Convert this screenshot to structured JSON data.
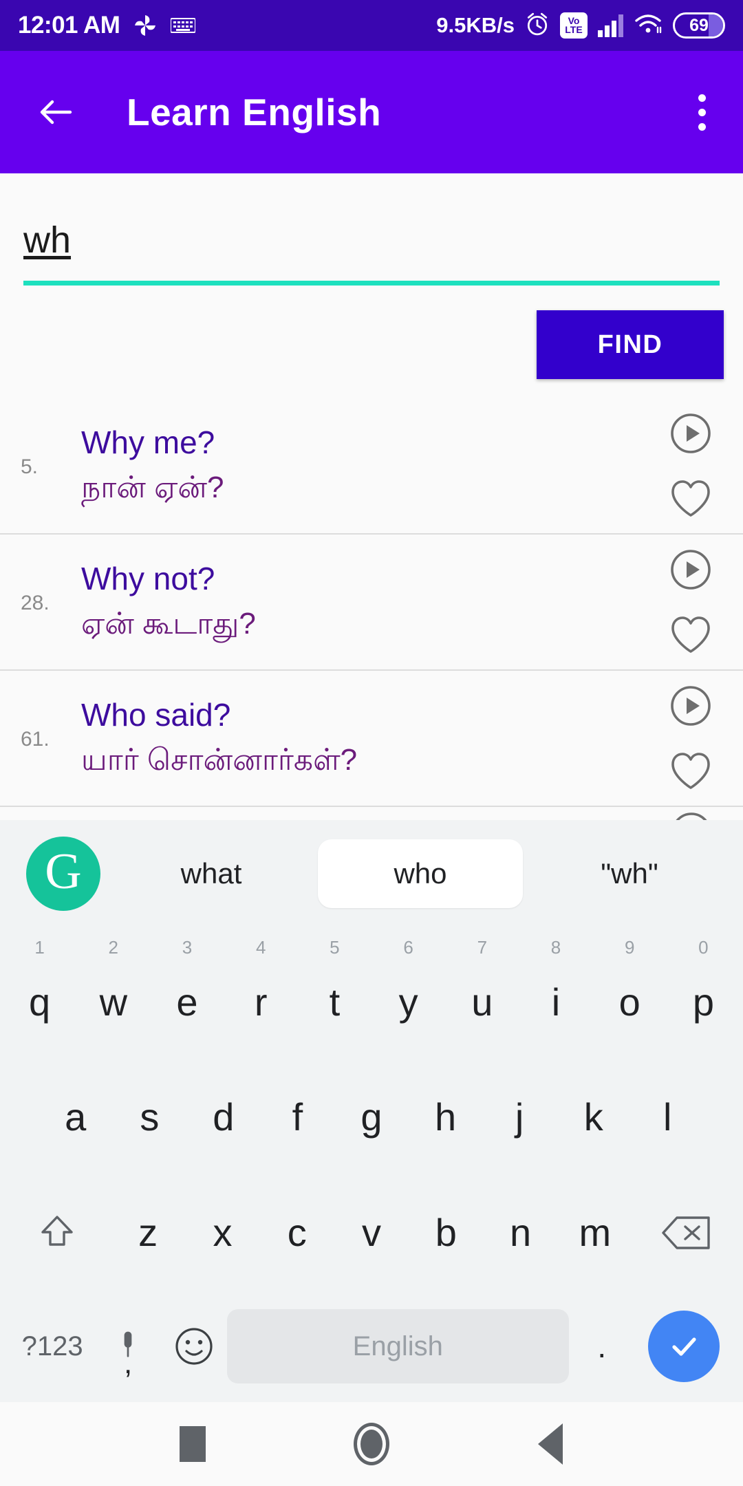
{
  "status_bar": {
    "time": "12:01 AM",
    "network_speed": "9.5KB/s",
    "volte_top": "Vo",
    "volte_bottom": "LTE",
    "battery_level": "69",
    "icons": [
      "pinwheel-icon",
      "keyboard-icon",
      "alarm-icon",
      "volte-icon",
      "signal-bars-icon",
      "wifi-icon",
      "battery-icon"
    ],
    "bg_color": "#3A06B0"
  },
  "app_bar": {
    "title": "Learn English",
    "back_icon": "back-arrow-icon",
    "overflow_icon": "kebab-menu-icon",
    "bg_color": "#6600EE"
  },
  "search": {
    "value": "wh",
    "placeholder": "",
    "underline_color": "#1DE0BE"
  },
  "find_button": {
    "label": "FIND",
    "bg_color": "#3300CC"
  },
  "results": [
    {
      "number": "5.",
      "english": "Why me?",
      "tamil": "நான் ஏன்?",
      "play_icon": "play-circle-icon",
      "favorite_icon": "heart-outline-icon"
    },
    {
      "number": "28.",
      "english": "Why not?",
      "tamil": "ஏன் கூடாது?",
      "play_icon": "play-circle-icon",
      "favorite_icon": "heart-outline-icon"
    },
    {
      "number": "61.",
      "english": "Who said?",
      "tamil": "யார் சொன்னார்கள்?",
      "play_icon": "play-circle-icon",
      "favorite_icon": "heart-outline-icon"
    }
  ],
  "result_colors": {
    "english": "#3D0C9E",
    "tamil": "#6B1B7B",
    "number": "#8a8a8a"
  },
  "keyboard": {
    "logo_letter": "G",
    "logo_name": "grammarly-logo-icon",
    "logo_color": "#15C39A",
    "suggestions": [
      {
        "text": "what",
        "active": false
      },
      {
        "text": "who",
        "active": true
      },
      {
        "text": "\"wh\"",
        "active": false
      }
    ],
    "row1": [
      {
        "letter": "q",
        "num": "1"
      },
      {
        "letter": "w",
        "num": "2"
      },
      {
        "letter": "e",
        "num": "3"
      },
      {
        "letter": "r",
        "num": "4"
      },
      {
        "letter": "t",
        "num": "5"
      },
      {
        "letter": "y",
        "num": "6"
      },
      {
        "letter": "u",
        "num": "7"
      },
      {
        "letter": "i",
        "num": "8"
      },
      {
        "letter": "o",
        "num": "9"
      },
      {
        "letter": "p",
        "num": "0"
      }
    ],
    "row2": [
      {
        "letter": "a"
      },
      {
        "letter": "s"
      },
      {
        "letter": "d"
      },
      {
        "letter": "f"
      },
      {
        "letter": "g"
      },
      {
        "letter": "h"
      },
      {
        "letter": "j"
      },
      {
        "letter": "k"
      },
      {
        "letter": "l"
      }
    ],
    "row3": [
      {
        "letter": "z"
      },
      {
        "letter": "x"
      },
      {
        "letter": "c"
      },
      {
        "letter": "v"
      },
      {
        "letter": "b"
      },
      {
        "letter": "n"
      },
      {
        "letter": "m"
      }
    ],
    "shift_icon": "shift-arrow-icon",
    "backspace_icon": "backspace-icon",
    "symbols_label": "?123",
    "mic_icon": "microphone-icon",
    "comma_label": ",",
    "emoji_icon": "emoji-smiley-icon",
    "space_label": "English",
    "period_label": ".",
    "enter_icon": "checkmark-icon",
    "enter_color": "#4285F4",
    "bg_color": "#F1F3F4"
  },
  "nav_bar": {
    "recents_icon": "square-recents-icon",
    "home_icon": "circle-home-icon",
    "back_icon": "triangle-back-icon"
  }
}
